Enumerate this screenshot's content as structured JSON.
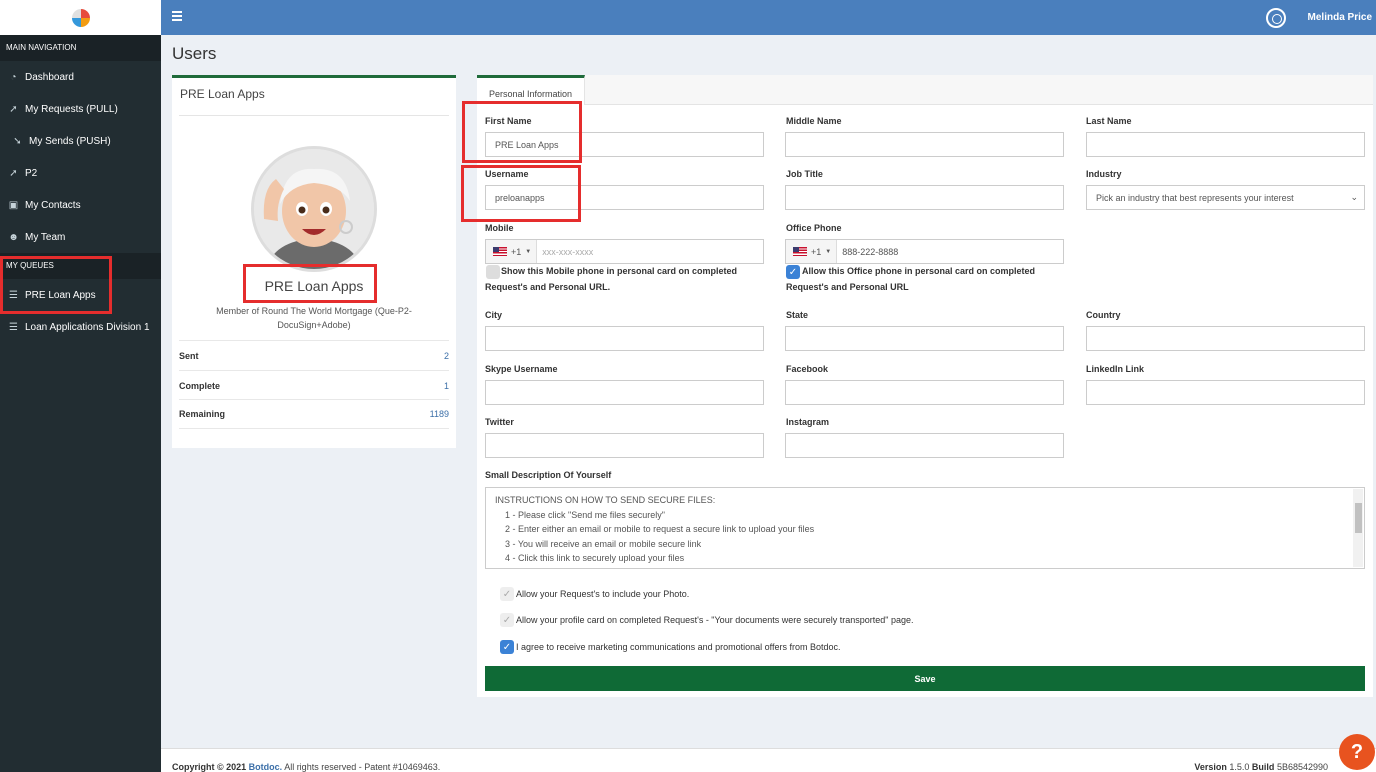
{
  "sidebar": {
    "main_nav_header": "MAIN NAVIGATION",
    "items": [
      {
        "label": "Dashboard",
        "icon": "dashboard-icon"
      },
      {
        "label": "My Requests (PULL)",
        "icon": "paper-plane-icon"
      },
      {
        "label": "My Sends (PUSH)",
        "icon": "send-icon"
      },
      {
        "label": "P2",
        "icon": "paper-plane-icon"
      },
      {
        "label": "My Contacts",
        "icon": "contact-book-icon"
      },
      {
        "label": "My Team",
        "icon": "users-icon"
      }
    ],
    "queues_header": "MY QUEUES",
    "queues": [
      {
        "label": "PRE Loan Apps",
        "icon": "list-icon"
      },
      {
        "label": "Loan Applications Division 1",
        "icon": "list-icon"
      }
    ]
  },
  "header": {
    "user_name": "Melinda Price"
  },
  "page": {
    "title": "Users"
  },
  "profile": {
    "card_title": "PRE Loan Apps",
    "name": "PRE Loan Apps",
    "member_text": "Member of Round The World Mortgage (Que-P2-DocuSign+Adobe)",
    "stats": [
      {
        "label": "Sent",
        "value": "2"
      },
      {
        "label": "Complete",
        "value": "1"
      },
      {
        "label": "Remaining",
        "value": "1189"
      }
    ]
  },
  "form": {
    "tab_label": "Personal Information",
    "first_name": {
      "label": "First Name",
      "value": "PRE Loan Apps"
    },
    "middle_name": {
      "label": "Middle Name",
      "value": ""
    },
    "last_name": {
      "label": "Last Name",
      "value": ""
    },
    "username": {
      "label": "Username",
      "value": "preloanapps"
    },
    "job_title": {
      "label": "Job Title",
      "value": ""
    },
    "industry": {
      "label": "Industry",
      "value": "Pick an industry that best represents your interest"
    },
    "mobile": {
      "label": "Mobile",
      "code": "+1",
      "placeholder": "xxx-xxx-xxxx",
      "value": ""
    },
    "office_phone": {
      "label": "Office Phone",
      "code": "+1",
      "value": "888-222-8888"
    },
    "mobile_check": {
      "line1": "Show this Mobile phone in personal card on completed",
      "line2": "Request's and Personal URL."
    },
    "office_check": {
      "line1": "Allow this Office phone in personal card on completed",
      "line2": "Request's and Personal URL"
    },
    "city": {
      "label": "City",
      "value": ""
    },
    "state": {
      "label": "State",
      "value": ""
    },
    "country": {
      "label": "Country",
      "value": ""
    },
    "skype": {
      "label": "Skype Username",
      "value": ""
    },
    "facebook": {
      "label": "Facebook",
      "value": ""
    },
    "linkedin": {
      "label": "LinkedIn Link",
      "value": ""
    },
    "twitter": {
      "label": "Twitter",
      "value": ""
    },
    "instagram": {
      "label": "Instagram",
      "value": ""
    },
    "description": {
      "label": "Small Description Of Yourself",
      "lines": [
        "INSTRUCTIONS ON HOW TO SEND SECURE FILES:",
        "    1 - Please click \"Send me files securely\"",
        "    2 - Enter either an email or mobile to request a secure link to upload your files",
        "    3 - You will receive an email or mobile secure link",
        "    4 - Click this link to securely upload your files"
      ]
    },
    "options": [
      "Allow your Request's to include your Photo.",
      "Allow your profile card on completed Request's - \"Your documents were securely transported\" page.",
      "I agree to receive marketing communications and promotional offers from Botdoc."
    ],
    "save_label": "Save"
  },
  "footer": {
    "copyright_prefix": "Copyright © 2021",
    "company": "Botdoc.",
    "copyright_suffix": "All rights reserved - Patent #10469463.",
    "version_label": "Version",
    "version": "1.5.0",
    "build_label": "Build",
    "build": "5B68542990"
  },
  "colors": {
    "sidebar_bg": "#222d32",
    "header_bg": "#4a7fbd",
    "save_button": "#0f6a36",
    "highlight": "#e52d2d",
    "help_button": "#e8531f"
  }
}
